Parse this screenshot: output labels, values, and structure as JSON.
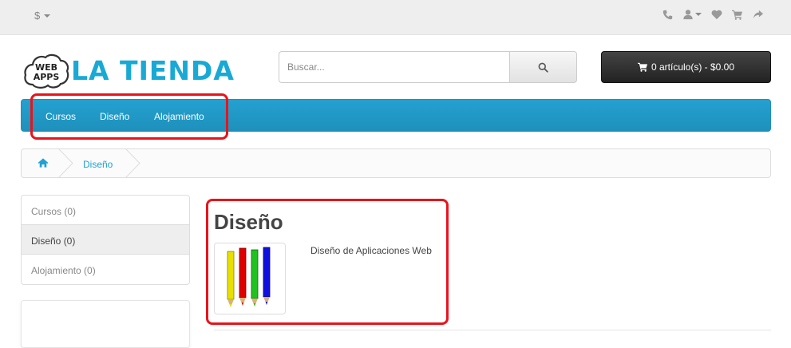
{
  "topbar": {
    "currency_symbol": "$",
    "icons": [
      "phone-icon",
      "user-icon",
      "heart-icon",
      "cart-icon",
      "share-icon"
    ]
  },
  "header": {
    "logo_badge_line1": "WEB",
    "logo_badge_line2": "APPS",
    "logo_text": "LA TIENDA",
    "brand_color": "#19a9d5"
  },
  "search": {
    "placeholder": "Buscar..."
  },
  "cart": {
    "label": "0 artículo(s) - $0.00"
  },
  "nav": {
    "items": [
      {
        "label": "Cursos"
      },
      {
        "label": "Diseño"
      },
      {
        "label": "Alojamiento"
      }
    ],
    "color": "#23a1d1"
  },
  "breadcrumb": {
    "current": "Diseño"
  },
  "sidebar": {
    "items": [
      {
        "label": "Cursos (0)"
      },
      {
        "label": "Diseño (0)"
      },
      {
        "label": "Alojamiento (0)"
      }
    ],
    "active_index": 1
  },
  "content": {
    "title": "Diseño",
    "subcategory": "Diseño de Aplicaciones Web"
  },
  "annotation_color": "#e8141b"
}
